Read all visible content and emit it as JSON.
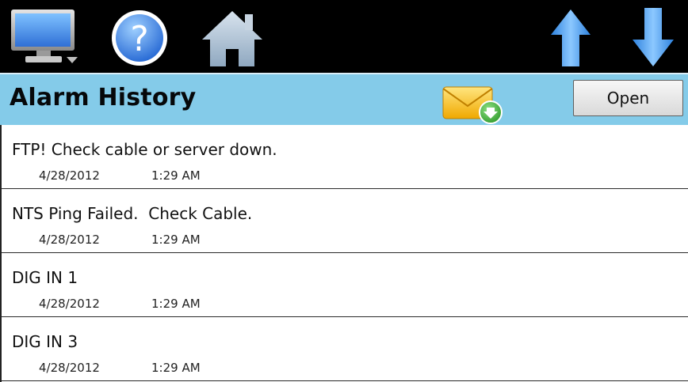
{
  "toolbar": {
    "icons": [
      "monitor-icon",
      "help-icon",
      "home-icon",
      "arrow-up-icon",
      "arrow-down-icon"
    ],
    "help_glyph": "?"
  },
  "header": {
    "title": "Alarm History",
    "open_label": "Open",
    "mail_icon": "mail-download-icon"
  },
  "alarms": [
    {
      "message": "FTP! Check cable or server down.",
      "date": "4/28/2012",
      "time": "1:29 AM"
    },
    {
      "message": "NTS Ping Failed.  Check Cable.",
      "date": "4/28/2012",
      "time": "1:29 AM"
    },
    {
      "message": "DIG IN 1",
      "date": "4/28/2012",
      "time": "1:29 AM"
    },
    {
      "message": "DIG IN 3",
      "date": "4/28/2012",
      "time": "1:29 AM"
    }
  ],
  "colors": {
    "toolbar_bg": "#000000",
    "header_bg": "#84cbe9",
    "icon_blue": "#4da0e8",
    "mail_yellow": "#f5c21b",
    "download_green": "#3fae3a"
  }
}
